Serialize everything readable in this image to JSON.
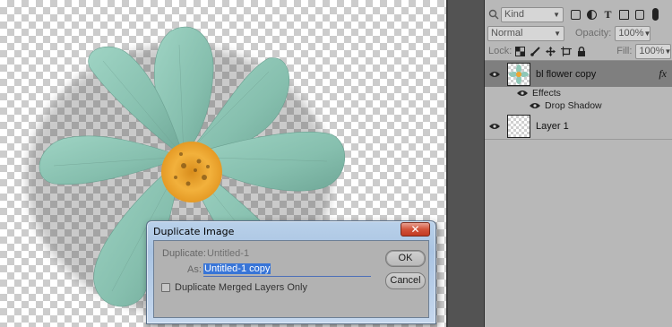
{
  "layers_panel": {
    "filter_kind": "Kind",
    "filter_icons": [
      "image-filter-icon",
      "adjustment-filter-icon",
      "type-filter-icon",
      "shape-filter-icon",
      "smart-object-filter-icon"
    ],
    "blend_mode": "Normal",
    "opacity_label": "Opacity:",
    "opacity_value": "100%",
    "lock_label": "Lock:",
    "lock_icons": [
      "lock-transparent-icon",
      "lock-brush-icon",
      "lock-move-icon",
      "lock-artboard-icon",
      "lock-all-icon"
    ],
    "fill_label": "Fill:",
    "fill_value": "100%",
    "layers": [
      {
        "name": "bl flower copy",
        "fx": "fx",
        "selected": true
      },
      {
        "name": "Layer 1",
        "selected": false
      }
    ],
    "effects_label": "Effects",
    "drop_shadow_label": "Drop Shadow"
  },
  "dialog": {
    "title": "Duplicate Image",
    "close_glyph": "✕",
    "duplicate_label": "Duplicate:",
    "duplicate_value": "Untitled-1",
    "as_label": "As:",
    "as_value": "Untitled-1 copy",
    "merged_label": "Duplicate Merged Layers Only",
    "merged_checked": false,
    "ok_label": "OK",
    "cancel_label": "Cancel"
  },
  "colors": {
    "petal": "#8fc7b7",
    "center": "#f0a531",
    "panel_bg": "#b8b8b8",
    "selected_layer": "#7f7f7f",
    "selection_highlight": "#3875d7"
  }
}
